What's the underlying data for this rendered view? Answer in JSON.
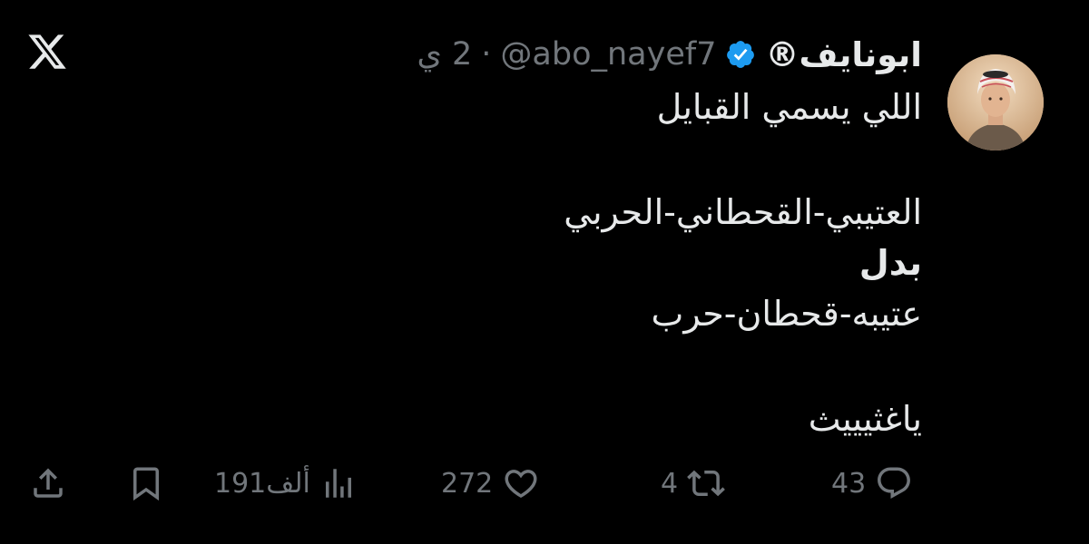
{
  "header": {
    "display_name": "ابونايف®",
    "handle": "@abo_nayef7",
    "separator": "·",
    "time": "2 ي"
  },
  "tweet": {
    "lines": [
      "اللي يسمي القبايل",
      "العتيبي-القحطاني-الحربي",
      "بدل",
      "عتيبه-قحطان-حرب",
      "ياغثيييث"
    ]
  },
  "actions": {
    "replies": "43",
    "reposts": "4",
    "likes": "272",
    "views": "191ألف"
  },
  "icons": {
    "logo": "x-logo-icon",
    "verified": "verified-badge-icon",
    "reply": "reply-icon",
    "repost": "repost-icon",
    "like": "heart-icon",
    "views": "views-icon",
    "bookmark": "bookmark-icon",
    "share": "share-icon"
  },
  "colors": {
    "background": "#000000",
    "text": "#e7e9ea",
    "secondary_text": "#71767b",
    "verified_badge": "#1d9bf0"
  }
}
